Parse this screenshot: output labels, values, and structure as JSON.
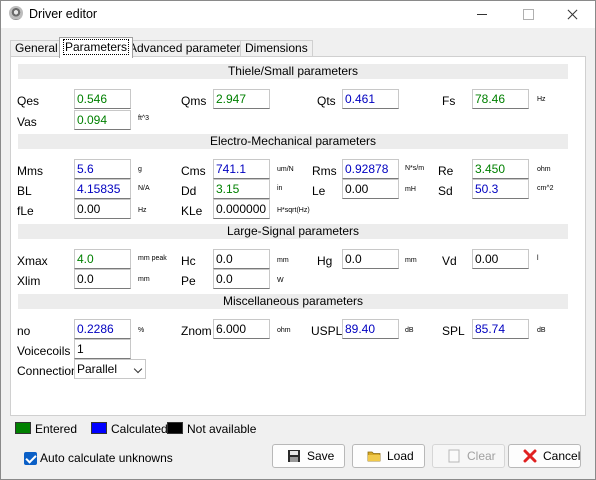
{
  "window": {
    "title": "Driver editor"
  },
  "tabs": [
    {
      "label": "General"
    },
    {
      "label": "Parameters"
    },
    {
      "label": "Advanced parameters"
    },
    {
      "label": "Dimensions"
    }
  ],
  "sections": {
    "ts": "Thiele/Small parameters",
    "em": "Electro-Mechanical parameters",
    "ls": "Large-Signal parameters",
    "misc": "Miscellaneous parameters"
  },
  "params": {
    "qes": {
      "label": "Qes",
      "value": "0.546",
      "state": "entered",
      "unit": ""
    },
    "qms": {
      "label": "Qms",
      "value": "2.947",
      "state": "entered",
      "unit": ""
    },
    "qts": {
      "label": "Qts",
      "value": "0.461",
      "state": "calculated",
      "unit": ""
    },
    "fs": {
      "label": "Fs",
      "value": "78.46",
      "state": "entered",
      "unit": "Hz"
    },
    "vas": {
      "label": "Vas",
      "value": "0.094",
      "state": "entered",
      "unit": "ft^3"
    },
    "mms": {
      "label": "Mms",
      "value": "5.6",
      "state": "calculated",
      "unit": "g"
    },
    "cms": {
      "label": "Cms",
      "value": "741.1",
      "state": "calculated",
      "unit": "um/N"
    },
    "rms": {
      "label": "Rms",
      "value": "0.92878",
      "state": "calculated",
      "unit": "N*s/m"
    },
    "re": {
      "label": "Re",
      "value": "3.450",
      "state": "entered",
      "unit": "ohm"
    },
    "bl": {
      "label": "BL",
      "value": "4.15835",
      "state": "calculated",
      "unit": "N/A"
    },
    "dd": {
      "label": "Dd",
      "value": "3.15",
      "state": "entered",
      "unit": "in"
    },
    "le": {
      "label": "Le",
      "value": "0.00",
      "state": "na",
      "unit": "mH"
    },
    "sd": {
      "label": "Sd",
      "value": "50.3",
      "state": "calculated",
      "unit": "cm^2"
    },
    "fle": {
      "label": "fLe",
      "value": "0.00",
      "state": "na",
      "unit": "Hz"
    },
    "kle": {
      "label": "KLe",
      "value": "0.000000",
      "state": "na",
      "unit": "H*sqrt(Hz)"
    },
    "xmax": {
      "label": "Xmax",
      "value": "4.0",
      "state": "entered",
      "unit": "mm peak"
    },
    "hc": {
      "label": "Hc",
      "value": "0.0",
      "state": "na",
      "unit": "mm"
    },
    "hg": {
      "label": "Hg",
      "value": "0.0",
      "state": "na",
      "unit": "mm"
    },
    "vd": {
      "label": "Vd",
      "value": "0.00",
      "state": "na",
      "unit": "l"
    },
    "xlim": {
      "label": "Xlim",
      "value": "0.0",
      "state": "na",
      "unit": "mm"
    },
    "pe": {
      "label": "Pe",
      "value": "0.0",
      "state": "na",
      "unit": "W"
    },
    "no": {
      "label": "no",
      "value": "0.2286",
      "state": "calculated",
      "unit": "%"
    },
    "znom": {
      "label": "Znom",
      "value": "6.000",
      "state": "na",
      "unit": "ohm"
    },
    "uspl": {
      "label": "USPL",
      "value": "89.40",
      "state": "calculated",
      "unit": "dB"
    },
    "spl": {
      "label": "SPL",
      "value": "85.74",
      "state": "calculated",
      "unit": "dB"
    },
    "voicecoils": {
      "label": "Voicecoils",
      "value": "1",
      "state": "na",
      "unit": ""
    }
  },
  "connection": {
    "label": "Connection",
    "value": "Parallel"
  },
  "legend": {
    "entered": {
      "label": "Entered",
      "color": "#008000"
    },
    "calculated": {
      "label": "Calculated",
      "color": "#0000ff"
    },
    "na": {
      "label": "Not available",
      "color": "#000000"
    }
  },
  "auto_calc": {
    "label": "Auto calculate unknowns",
    "checked": true
  },
  "buttons": {
    "save": "Save",
    "load": "Load",
    "clear": "Clear",
    "cancel": "Cancel"
  },
  "colors": {
    "entered_text": "#008000",
    "calculated_text": "#0000c0"
  }
}
